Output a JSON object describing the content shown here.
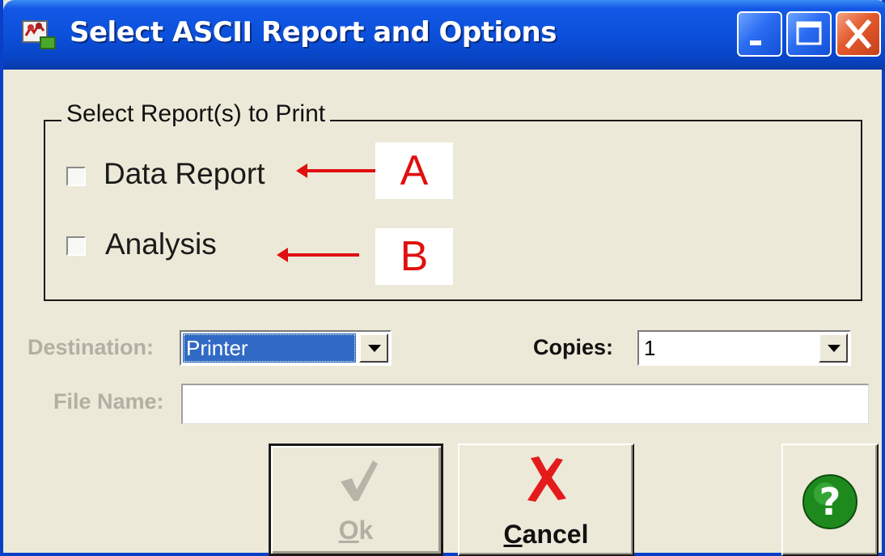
{
  "window": {
    "title": "Select ASCII Report and Options",
    "accent_color": "#0a4fd9",
    "controls": {
      "minimize_icon": "minimize-icon",
      "maximize_icon": "maximize-icon",
      "close_icon": "close-icon"
    }
  },
  "report_group": {
    "label": "Select Report(s) to Print",
    "options": [
      {
        "label": "Data Report",
        "checked": false
      },
      {
        "label": "Analysis",
        "checked": false
      }
    ]
  },
  "annotations": [
    {
      "letter": "A",
      "color": "#e01010"
    },
    {
      "letter": "B",
      "color": "#e01010"
    }
  ],
  "destination": {
    "label": "Destination:",
    "value": "Printer",
    "enabled": false
  },
  "copies": {
    "label": "Copies:",
    "value": "1"
  },
  "file_name": {
    "label": "File Name:",
    "value": "",
    "enabled": false
  },
  "buttons": {
    "ok": {
      "label": "Ok",
      "mnemonic": "O",
      "enabled": false,
      "icon": "checkmark-icon"
    },
    "cancel": {
      "label": "Cancel",
      "mnemonic": "C",
      "enabled": true,
      "icon": "red-x-icon"
    },
    "help": {
      "icon": "question-mark-icon",
      "color": "#1e8a1e"
    }
  }
}
